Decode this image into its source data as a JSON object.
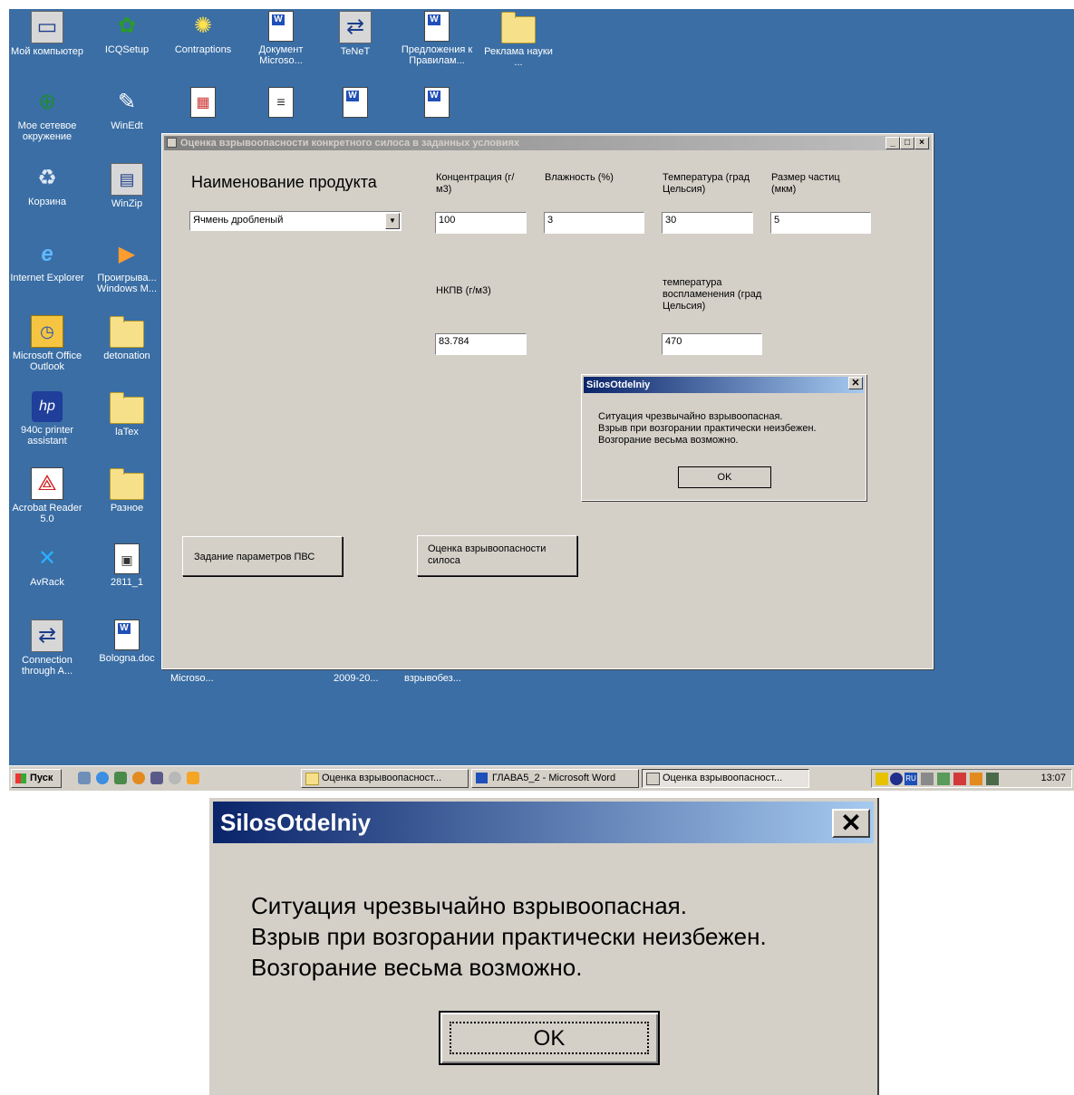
{
  "desktop": {
    "icons": [
      {
        "id": "my-computer",
        "label": "Мой компьютер",
        "icon": "computer-icon"
      },
      {
        "id": "icqsetup",
        "label": "ICQSetup",
        "icon": "icq-icon"
      },
      {
        "id": "contraptions",
        "label": "Contraptions",
        "icon": "shortcut-icon"
      },
      {
        "id": "doc-microsoft",
        "label": "Документ Microso...",
        "icon": "word-doc-icon"
      },
      {
        "id": "tenet",
        "label": "TeNeT",
        "icon": "network-connection-icon"
      },
      {
        "id": "proposals",
        "label": "Предложения к Правилам...",
        "icon": "word-doc-icon"
      },
      {
        "id": "reklama",
        "label": "Реклама науки ...",
        "icon": "folder-icon"
      },
      {
        "id": "network",
        "label": "Мое сетевое окружение",
        "icon": "network-places-icon"
      },
      {
        "id": "winedt",
        "label": "WinEdt",
        "icon": "pen-icon"
      },
      {
        "id": "recycle",
        "label": "Корзина",
        "icon": "recycle-bin-icon"
      },
      {
        "id": "winzip",
        "label": "WinZip",
        "icon": "winzip-icon"
      },
      {
        "id": "ie",
        "label": "Internet Explorer",
        "icon": "ie-icon"
      },
      {
        "id": "wmp",
        "label": "Проигрыва... Windows M...",
        "icon": "media-player-icon"
      },
      {
        "id": "outlook",
        "label": "Microsoft Office Outlook",
        "icon": "outlook-icon"
      },
      {
        "id": "detonation",
        "label": "detonation",
        "icon": "folder-icon"
      },
      {
        "id": "printer",
        "label": "940c printer assistant",
        "icon": "hp-icon"
      },
      {
        "id": "latex",
        "label": "laTex",
        "icon": "folder-icon"
      },
      {
        "id": "acrobat",
        "label": "Acrobat Reader 5.0",
        "icon": "acrobat-icon"
      },
      {
        "id": "raznoe",
        "label": "Разное",
        "icon": "folder-icon"
      },
      {
        "id": "avrack",
        "label": "AvRack",
        "icon": "avrack-icon"
      },
      {
        "id": "f2811",
        "label": "2811_1",
        "icon": "media-file-icon"
      },
      {
        "id": "connection",
        "label": "Connection through A...",
        "icon": "network-connection-icon"
      },
      {
        "id": "bologna",
        "label": "Bologna.doc",
        "icon": "word-doc-icon"
      }
    ],
    "hidden_labels": [
      "Microso...",
      "2009-20...",
      "взрывобез..."
    ]
  },
  "window": {
    "title": "Оценка взрывоопасности конкретного силоса в заданных условиях",
    "product_label": "Наименование продукта",
    "product_value": "Ячмень дробленый",
    "concentration_label": "Концентрация (г/м3)",
    "concentration_value": "100",
    "humidity_label": "Влажность (%)",
    "humidity_value": "3",
    "temperature_label": "Температура (град Цельсия)",
    "temperature_value": "30",
    "particle_label": "Размер частиц (мкм)",
    "particle_value": "5",
    "nkpv_label": "НКПВ (г/м3)",
    "nkpv_value": "83.784",
    "ignition_label": "температура воспламенения (град Цельсия)",
    "ignition_value": "470",
    "params_button": "Задание параметров ПВС",
    "evaluate_button": "Оценка взрывоопасности силоса"
  },
  "dialog": {
    "title": "SilosOtdelniy",
    "line1": "Ситуация чрезвычайно взрывоопасная.",
    "line2": "Взрыв при возгорании практически неизбежен.",
    "line3": "Возгорание весьма возможно.",
    "ok": "OK"
  },
  "taskbar": {
    "start": "Пуск",
    "tasks": [
      "Оценка взрывоопасност...",
      "ГЛАВА5_2 - Microsoft Word",
      "Оценка взрывоопасност..."
    ],
    "tray_lang": "RU",
    "clock": "13:07"
  }
}
